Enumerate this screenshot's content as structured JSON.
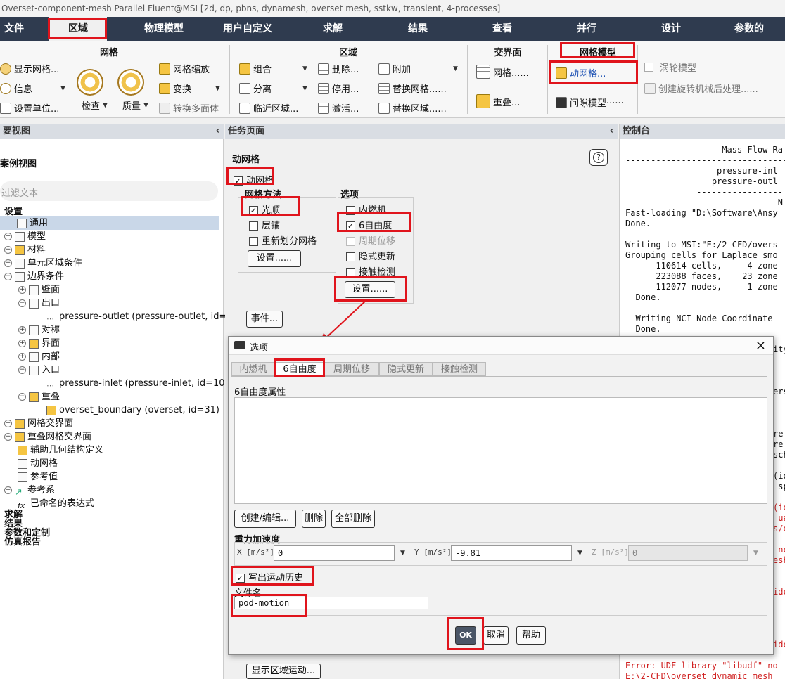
{
  "window": {
    "title": "Overset-component-mesh Parallel Fluent@MSI  [2d, dp, pbns, dynamesh, overset mesh, sstkw, transient, 4-processes]"
  },
  "menu": {
    "tabs": [
      "文件",
      "区域",
      "物理模型",
      "用户自定义",
      "求解",
      "结果",
      "查看",
      "并行",
      "设计",
      "参数的"
    ],
    "active": "区域"
  },
  "ribbon": {
    "mesh_group": {
      "title": "网格",
      "show_mesh": "显示网格...",
      "info": "信息",
      "set_units": "设置单位...",
      "check": "检查",
      "quality": "质量",
      "scale": "网格缩放",
      "transform": "变换",
      "convert_polyhedra": "转换多面体"
    },
    "zone_group": {
      "title": "区域",
      "combine": "组合",
      "separate": "分离",
      "adjacency": "临近区域...",
      "delete": "删除...",
      "deactivate": "停用...",
      "activate": "激活...",
      "append": "附加",
      "replace_mesh": "替换网格......",
      "replace_zone": "替换区域......"
    },
    "interface_group": {
      "title": "交界面",
      "mesh": "网格......",
      "overlap": "重叠..."
    },
    "mesh_models_group": {
      "title": "网格模型",
      "dynamic_mesh": "动网格...",
      "gap_model": "间隙模型······"
    },
    "turbo_group": {
      "turbo_model": "涡轮模型",
      "turbo_postprocess": "创建旋转机械后处理......"
    }
  },
  "left_panel": {
    "header": "要视图",
    "subheader": "案例视图",
    "filter_placeholder": "过滤文本",
    "tree": {
      "setup": "设置",
      "general": "通用",
      "models": "模型",
      "materials": "材料",
      "cell_zones": "单元区域条件",
      "boundary_conditions": "边界条件",
      "wall": "壁面",
      "outlet": "出口",
      "pressure_outlet": "pressure-outlet (pressure-outlet, id=",
      "symmetry": "对称",
      "interface": "界面",
      "interior": "内部",
      "inlet": "入口",
      "pressure_inlet": "pressure-inlet (pressure-inlet, id=10",
      "overset": "重叠",
      "overset_boundary": "overset_boundary (overset, id=31)",
      "mesh_interfaces": "网格交界面",
      "overset_interfaces": "重叠网格交界面",
      "geometry_defs": "辅助几何结构定义",
      "dynamic_mesh": "动网格",
      "reference_values": "参考值",
      "reference_frames": "参考系",
      "named_expressions": "已命名的表达式",
      "solution": "求解",
      "results": "结果",
      "params": "参数和定制",
      "report": "仿真报告"
    }
  },
  "task_page": {
    "header": "任务页面",
    "title": "动网格",
    "help_icon": "?",
    "dynamic_mesh_checkbox": "动网格",
    "mesh_methods_title": "网格方法",
    "smoothing": "光顺",
    "layering": "层铺",
    "remeshing": "重新划分网格",
    "methods_settings": "设置......",
    "options_title": "选项",
    "ic_engine": "内燃机",
    "six_dof": "6自由度",
    "periodic_displacement": "周期位移",
    "implicit_update": "隐式更新",
    "contact_detection": "接触检测",
    "options_settings": "设置......",
    "events": "事件...",
    "display_zone_motion": "显示区域运动..."
  },
  "console": {
    "header": "控制台",
    "lines": [
      "                   Mass Flow Ra",
      "--------------------------------",
      "                  pressure-inl",
      "                 pressure-outl",
      "              -----------------",
      "                              N",
      "Fast-loading \"D:\\Software\\Ansy",
      "Done.",
      "",
      "Writing to MSI:\"E:/2-CFD/overs",
      "Grouping cells for Laplace smo",
      "      110614 cells,     4 zone",
      "      223088 faces,    23 zone",
      "      112077 nodes,     1 zone",
      "  Done.",
      "",
      "  Writing NCI Node Coordinate",
      "  Done."
    ],
    "tail_lines": [
      "ity",
      "",
      "",
      "",
      "ers",
      "",
      "",
      "",
      "re",
      "re",
      "sch",
      "",
      "(id",
      " sp",
      "",
      "(id",
      " ua",
      "s/d",
      "",
      " ne",
      "esh",
      "",
      "",
      "ide",
      "",
      "",
      "",
      "",
      "ide"
    ],
    "error_line1": "Error: UDF library \"libudf\" no",
    "error_line2": "E:\\2-CFD\\overset_dynamic_mesh"
  },
  "dialog": {
    "title": "选项",
    "tabs": [
      "内燃机",
      "6自由度",
      "周期位移",
      "隐式更新",
      "接触检测"
    ],
    "active_tab": "6自由度",
    "props_label": "6自由度属性",
    "create_edit": "创建/编辑...",
    "delete": "删除",
    "delete_all": "全部删除",
    "gravity_label": "重力加速度",
    "x_unit": "X [m/s²]",
    "x_value": "0",
    "y_unit": "Y [m/s²]",
    "y_value": "-9.81",
    "z_unit": "Z [m/s²]",
    "z_value": "0",
    "write_history": "写出运动历史",
    "filename_label": "文件名",
    "filename_value": "pod-motion",
    "ok": "OK",
    "cancel": "取消",
    "help": "帮助"
  }
}
